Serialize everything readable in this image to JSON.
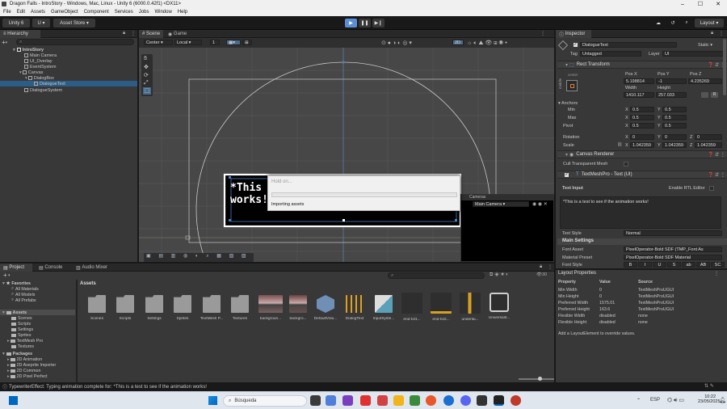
{
  "window": {
    "title": "Dragon Falls - IntroStory - Windows, Mac, Linux - Unity 6 (6000.0.42f1) <DX11>"
  },
  "menu": [
    "File",
    "Edit",
    "Assets",
    "GameObject",
    "Component",
    "Services",
    "Jobs",
    "Window",
    "Help"
  ],
  "toolbar": {
    "account": "Unity 6",
    "u_label": "U",
    "asset_store": "Asset Store",
    "layout": "Layout"
  },
  "hierarchy": {
    "tab": "Hierarchy",
    "items": [
      "IntroStory",
      "Main Camera",
      "UI_Overlay",
      "EventSystem",
      "Canvas",
      "DialogBox",
      "DialogueText",
      "DialogueSystem"
    ]
  },
  "scene": {
    "tabs": [
      "Scene",
      "Game"
    ],
    "pivot": "Center",
    "space": "Local",
    "grid_value": "1",
    "mode_2d": "2D",
    "text_line1": "*This",
    "text_line2": "works!",
    "cameras_label": "Cameras",
    "camera_select": "Main Camera"
  },
  "progress": {
    "title": "Hold on...",
    "status": "Importing assets"
  },
  "inspector": {
    "tab": "Inspector",
    "object_name": "DialogueText",
    "static_label": "Static",
    "tag_label": "Tag",
    "tag_value": "Untagged",
    "layer_label": "Layer",
    "layer_value": "UI",
    "rect_transform": "Rect Transform",
    "anchor_label": "center",
    "side_label": "middle",
    "pos_x_label": "Pos X",
    "pos_y_label": "Pos Y",
    "pos_z_label": "Pos Z",
    "pos_x": "5.198814",
    "pos_y": "-1",
    "pos_z": "4.235269",
    "width_label": "Width",
    "height_label": "Height",
    "width": "1410.117",
    "height": "257.033",
    "anchors_label": "Anchors",
    "min_label": "Min",
    "max_label": "Max",
    "x_label": "X",
    "y_label": "Y",
    "z_label": "Z",
    "min_x": "0.5",
    "min_y": "0.5",
    "max_x": "0.5",
    "max_y": "0.5",
    "pivot_label": "Pivot",
    "pivot_x": "0.5",
    "pivot_y": "0.5",
    "rotation_label": "Rotation",
    "rot_x": "0",
    "rot_y": "0",
    "rot_z": "0",
    "scale_label": "Scale",
    "scale_x": "1.042359",
    "scale_y": "1.042359",
    "scale_z": "1.042359",
    "canvas_renderer": "Canvas Renderer",
    "cull_label": "Cull Transparent Mesh",
    "tmp_header": "TextMeshPro - Text (UI)",
    "text_input_label": "Text Input",
    "rtl_label": "Enable RTL Editor",
    "text_input_value": "*This is a test to see if the animation works!",
    "text_style_label": "Text Style",
    "text_style_value": "Normal",
    "main_settings": "Main Settings",
    "font_asset_label": "Font Asset",
    "font_asset_value": "PixelOperator-Bold SDF (TMP_Font As",
    "material_preset_label": "Material Preset",
    "material_preset_value": "PixelOperator-Bold SDF Material",
    "font_style_label": "Font Style",
    "font_style_buttons": [
      "B",
      "I",
      "U",
      "S",
      "ab",
      "AB",
      "SC"
    ]
  },
  "layout_props": {
    "title": "Layout Properties",
    "headers": [
      "Property",
      "Value",
      "Source"
    ],
    "rows": [
      [
        "Min Width",
        "0",
        "TextMeshProUGUI"
      ],
      [
        "Min Height",
        "0",
        "TextMeshProUGUI"
      ],
      [
        "Preferred Width",
        "1575.01",
        "TextMeshProUGUI"
      ],
      [
        "Preferred Height",
        "163.6",
        "TextMeshProUGUI"
      ],
      [
        "Flexible Width",
        "disabled",
        "none"
      ],
      [
        "Flexible Height",
        "disabled",
        "none"
      ]
    ],
    "hint": "Add a LayoutElement to override values."
  },
  "project": {
    "tabs": [
      "Project",
      "Console",
      "Audio Mixer"
    ],
    "favorites_label": "Favorites",
    "favorites": [
      "All Materials",
      "All Models",
      "All Prefabs"
    ],
    "assets_label": "Assets",
    "asset_folders": [
      "Scenes",
      "Scripts",
      "Settings",
      "Sprites",
      "TextMesh Pro",
      "Textures"
    ],
    "packages_label": "Packages",
    "packages": [
      "2D Animation",
      "2D Aseprite Importer",
      "2D Common",
      "2D Pixel Perfect"
    ],
    "breadcrumb": "Assets",
    "count": "30",
    "grid_items": [
      "Scenes",
      "Scripts",
      "Settings",
      "Sprites",
      "TextMesh P...",
      "Textures",
      "backgroun...",
      "backgro...",
      "DefaultVolu...",
      "DialogText",
      "InputSyste...",
      "end-txt1...",
      "end-txt2...",
      "underlai...",
      "Universalit..."
    ]
  },
  "statusbar": {
    "message": "TypewriterEffect: Typing animation complete for: *This is a test to see if the animation works!"
  },
  "taskbar": {
    "search": "Búsqueda",
    "lang": "ESP",
    "time": "10:22",
    "date": "23/05/2025"
  },
  "colors": {
    "accent": "#4a7fc1",
    "panel": "#383838",
    "dark": "#191919",
    "selection": "#2c5d87",
    "unity_blue": "#5c8ed6"
  }
}
